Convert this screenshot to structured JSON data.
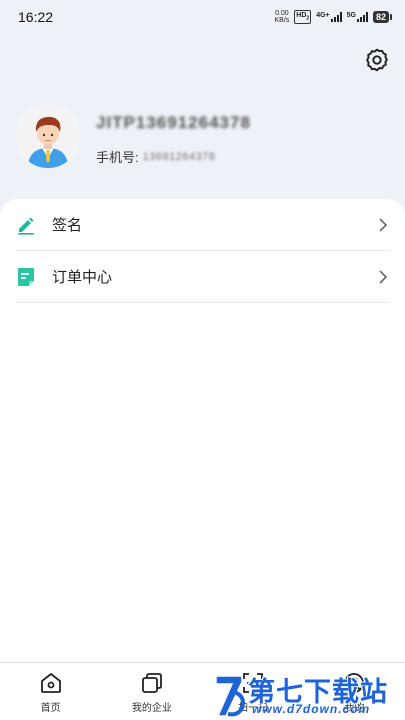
{
  "status_bar": {
    "time": "16:22",
    "net_speed_value": "0.00",
    "net_speed_unit": "KB/s",
    "hd_label": "HD",
    "hd_sub": "2",
    "sig1_label": "4G+",
    "sig2_label": "5G",
    "battery": "82"
  },
  "profile": {
    "username": "JITP13691264378",
    "phone_label": "手机号:",
    "phone_value": "13691264378",
    "settings_icon": "gear-icon"
  },
  "menu": [
    {
      "label": "签名",
      "icon": "pen-icon",
      "color": "#1bb89a"
    },
    {
      "label": "订单中心",
      "icon": "document-icon",
      "color": "#2cc5a4"
    }
  ],
  "tabs": [
    {
      "label": "首页",
      "icon": "home-icon"
    },
    {
      "label": "我的企业",
      "icon": "layers-icon"
    },
    {
      "label": "扫一扫",
      "icon": "scan-icon"
    },
    {
      "label": "我的",
      "icon": "user-icon"
    }
  ],
  "watermark": {
    "title": "第七下载站",
    "url": "www.d7down.com",
    "brand_color": "#1f63d8"
  }
}
